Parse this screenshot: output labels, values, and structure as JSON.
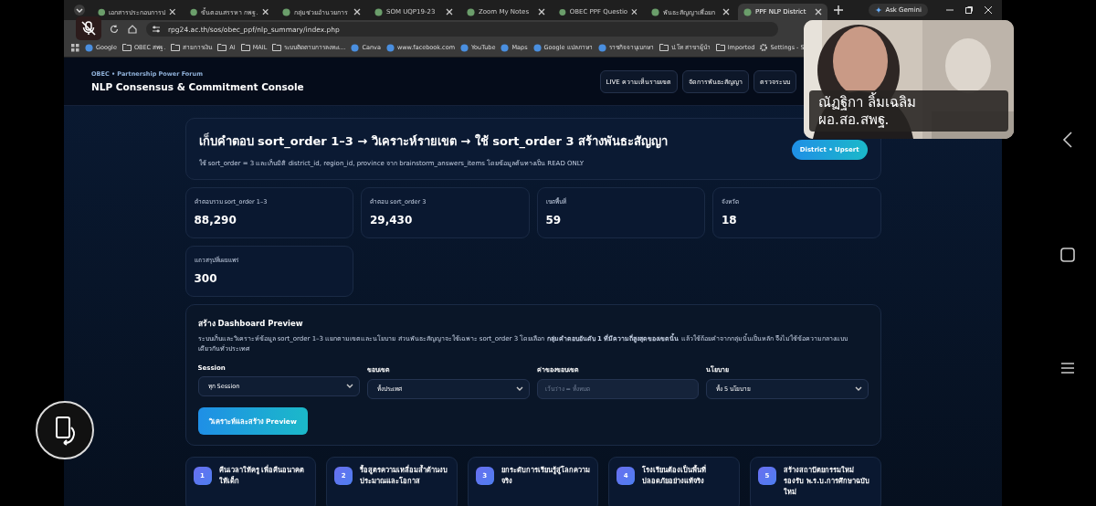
{
  "browser": {
    "tabs": [
      {
        "label": "เอกสารประกอบการป",
        "selected": false
      },
      {
        "label": "ขั้นตอนสรรหา กพฐ.",
        "selected": false
      },
      {
        "label": "กลุ่มช่วยอำนวยการ",
        "selected": false
      },
      {
        "label": "SOM UQP19-23",
        "selected": false
      },
      {
        "label": "Zoom My Notes",
        "selected": false
      },
      {
        "label": "OBEC PPF Questio",
        "selected": false
      },
      {
        "label": "พันธะสัญญาเพื่อยก",
        "selected": false
      },
      {
        "label": "PPF NLP District",
        "selected": true
      }
    ],
    "ask": "Ask Gemini",
    "address": "rpg24.ac.th/sos/obec_ppf/nlp_summary/index.php",
    "bookmarks": [
      {
        "label": "Google",
        "kind": "site"
      },
      {
        "label": "OBEC สพฐ.",
        "kind": "folder"
      },
      {
        "label": "สายการเงิน",
        "kind": "folder"
      },
      {
        "label": "AI",
        "kind": "folder"
      },
      {
        "label": "MAIL",
        "kind": "folder"
      },
      {
        "label": "ระบบติดตามการลงทะเ...",
        "kind": "folder"
      },
      {
        "label": "Canva",
        "kind": "site"
      },
      {
        "label": "www.facebook.com",
        "kind": "site"
      },
      {
        "label": "YouTube",
        "kind": "site"
      },
      {
        "label": "Maps",
        "kind": "site"
      },
      {
        "label": "Google แปลภาษา",
        "kind": "site"
      },
      {
        "label": "ราชกิจจานุเบกษา",
        "kind": "site"
      },
      {
        "label": "ป.โท สาขาผู้นำ",
        "kind": "folder"
      },
      {
        "label": "Imported",
        "kind": "folder"
      },
      {
        "label": "Settings - S",
        "kind": "settings"
      }
    ]
  },
  "header": {
    "kicker": "OBEC • Partnership Power Forum",
    "title": "NLP Consensus & Commitment Console",
    "nav": [
      "LIVE ความเห็นรายเขต",
      "จัดการพันธะสัญญา",
      "ตรวจระบบ"
    ]
  },
  "hero": {
    "title": "เก็บคำตอบ sort_order 1–3 → วิเคราะห์รายเขต → ใช้ sort_order 3 สร้างพันธะสัญญา",
    "subtitle": "ใช้ sort_order = 3 และเก็บมิติ district_id, region_id, province จาก brainstorm_answers_items โดยข้อมูลต้นทางเป็น READ ONLY",
    "badge": "District • Upsert"
  },
  "stats": [
    {
      "label": "คำตอบรวม sort_order 1–3",
      "value": "88,290"
    },
    {
      "label": "คำตอบ sort_order 3",
      "value": "29,430"
    },
    {
      "label": "เขตพื้นที่",
      "value": "59"
    },
    {
      "label": "จังหวัด",
      "value": "18"
    },
    {
      "label": "แถวสรุปที่เผยแพร่",
      "value": "300"
    }
  ],
  "preview": {
    "title": "สร้าง Dashboard Preview",
    "description": "ระบบเก็บและวิเคราะห์ข้อมูล sort_order 1–3 แยกตามเขตและนโยบาย ส่วนพันธะสัญญาจะใช้เฉพาะ sort_order 3 โดยเลือก **กลุ่มคำตอบอันดับ 1 ที่มีความถี่สูงสุดของเขตนั้น** แล้วใช้ถ้อยคำจากกลุ่มนั้นเป็นหลัก จึงไม่ใช้ข้อความกลางแบบเดียวกันทั่วประเทศ",
    "fields": [
      {
        "label": "Session",
        "kind": "select",
        "value": "ทุก Session"
      },
      {
        "label": "ขอบเขต",
        "kind": "select",
        "value": "ทั้งประเทศ"
      },
      {
        "label": "ค่าของขอบเขต",
        "kind": "input",
        "placeholder": "เว้นว่าง = ทั้งหมด"
      },
      {
        "label": "นโยบาย",
        "kind": "select",
        "value": "ทั้ง 5 นโยบาย"
      }
    ],
    "button": "วิเคราะห์และสร้าง Preview"
  },
  "policies": [
    {
      "number": "1",
      "text": "คืนเวลาให้ครู เพื่อคืนอนาคตให้เด็ก"
    },
    {
      "number": "2",
      "text": "รื้อสูตรความเหลื่อมล้ำด้านงบประมาณและโอกาส"
    },
    {
      "number": "3",
      "text": "ยกระดับการเรียนรู้สู่โลกความจริง"
    },
    {
      "number": "4",
      "text": "โรงเรียนต้องเป็นพื้นที่ปลอดภัยอย่างแท้จริง"
    },
    {
      "number": "5",
      "text": "สร้างสถาปัตยกรรมใหม่รองรับ พ.ร.บ.การศึกษาฉบับใหม่"
    }
  ],
  "video": {
    "name": "ณัฏฐิกา ลิ้มเฉลิม",
    "role": "ผอ.สอ.สพฐ."
  }
}
